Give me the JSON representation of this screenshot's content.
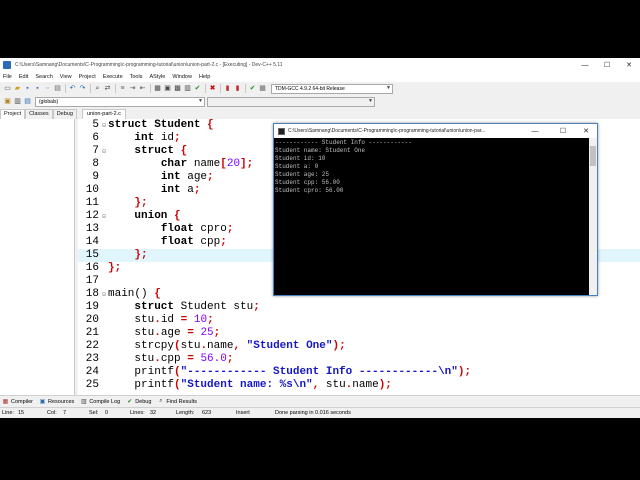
{
  "window": {
    "title": "C:\\Users\\Samnang\\Documents\\C-Programming\\c-programming-tutorial\\union\\union-part-2.c - [Executing] - Dev-C++ 5.11",
    "minimize": "—",
    "maximize": "☐",
    "close": "✕"
  },
  "menu": [
    "File",
    "Edit",
    "Search",
    "View",
    "Project",
    "Execute",
    "Tools",
    "AStyle",
    "Window",
    "Help"
  ],
  "toolbar": {
    "compiler_combo": "TDM-GCC 4.9.2 64-bit Release",
    "scope_combo": "(globals)",
    "symbol_combo": ""
  },
  "left_panel": {
    "tabs": [
      "Project",
      "Classes",
      "Debug"
    ]
  },
  "editor": {
    "tab_label": "union-part-2.c",
    "lines": [
      {
        "n": "5",
        "fold": "⊟",
        "hl": false,
        "segs": [
          [
            "kw",
            "struct Student "
          ],
          [
            "sym",
            "{"
          ]
        ]
      },
      {
        "n": "6",
        "fold": "",
        "hl": false,
        "segs": [
          [
            "t",
            "    "
          ],
          [
            "kw",
            "int"
          ],
          [
            "t",
            " id"
          ],
          [
            "sym",
            ";"
          ]
        ]
      },
      {
        "n": "7",
        "fold": "⊟",
        "hl": false,
        "segs": [
          [
            "t",
            "    "
          ],
          [
            "kw",
            "struct"
          ],
          [
            "t",
            " "
          ],
          [
            "sym",
            "{"
          ]
        ]
      },
      {
        "n": "8",
        "fold": "",
        "hl": false,
        "segs": [
          [
            "t",
            "        "
          ],
          [
            "kw",
            "char"
          ],
          [
            "t",
            " name"
          ],
          [
            "sym",
            "["
          ],
          [
            "num",
            "20"
          ],
          [
            "sym",
            "];"
          ]
        ]
      },
      {
        "n": "9",
        "fold": "",
        "hl": false,
        "segs": [
          [
            "t",
            "        "
          ],
          [
            "kw",
            "int"
          ],
          [
            "t",
            " age"
          ],
          [
            "sym",
            ";"
          ]
        ]
      },
      {
        "n": "10",
        "fold": "",
        "hl": false,
        "segs": [
          [
            "t",
            "        "
          ],
          [
            "kw",
            "int"
          ],
          [
            "t",
            " a"
          ],
          [
            "sym",
            ";"
          ]
        ]
      },
      {
        "n": "11",
        "fold": "",
        "hl": false,
        "segs": [
          [
            "t",
            "    "
          ],
          [
            "sym",
            "};"
          ]
        ]
      },
      {
        "n": "12",
        "fold": "⊟",
        "hl": false,
        "segs": [
          [
            "t",
            "    "
          ],
          [
            "kw",
            "union"
          ],
          [
            "t",
            " "
          ],
          [
            "sym",
            "{"
          ]
        ]
      },
      {
        "n": "13",
        "fold": "",
        "hl": false,
        "segs": [
          [
            "t",
            "        "
          ],
          [
            "kw",
            "float"
          ],
          [
            "t",
            " cpro"
          ],
          [
            "sym",
            ";"
          ]
        ]
      },
      {
        "n": "14",
        "fold": "",
        "hl": false,
        "segs": [
          [
            "t",
            "        "
          ],
          [
            "kw",
            "float"
          ],
          [
            "t",
            " cpp"
          ],
          [
            "sym",
            ";"
          ]
        ]
      },
      {
        "n": "15",
        "fold": "",
        "hl": true,
        "segs": [
          [
            "t",
            "    "
          ],
          [
            "sym",
            "};"
          ]
        ]
      },
      {
        "n": "16",
        "fold": "",
        "hl": false,
        "segs": [
          [
            "sym",
            "};"
          ]
        ]
      },
      {
        "n": "17",
        "fold": "",
        "hl": false,
        "segs": []
      },
      {
        "n": "18",
        "fold": "⊟",
        "hl": false,
        "segs": [
          [
            "t",
            "main() "
          ],
          [
            "sym",
            "{"
          ]
        ]
      },
      {
        "n": "19",
        "fold": "",
        "hl": false,
        "segs": [
          [
            "t",
            "    "
          ],
          [
            "kw",
            "struct"
          ],
          [
            "t",
            " Student stu"
          ],
          [
            "sym",
            ";"
          ]
        ]
      },
      {
        "n": "20",
        "fold": "",
        "hl": false,
        "segs": [
          [
            "t",
            "    stu"
          ],
          [
            "sym",
            "."
          ],
          [
            "t",
            "id "
          ],
          [
            "sym",
            "="
          ],
          [
            "t",
            " "
          ],
          [
            "num",
            "10"
          ],
          [
            "sym",
            ";"
          ]
        ]
      },
      {
        "n": "21",
        "fold": "",
        "hl": false,
        "segs": [
          [
            "t",
            "    stu"
          ],
          [
            "sym",
            "."
          ],
          [
            "t",
            "age "
          ],
          [
            "sym",
            "="
          ],
          [
            "t",
            " "
          ],
          [
            "num",
            "25"
          ],
          [
            "sym",
            ";"
          ]
        ]
      },
      {
        "n": "22",
        "fold": "",
        "hl": false,
        "segs": [
          [
            "t",
            "    strcpy"
          ],
          [
            "sym",
            "("
          ],
          [
            "t",
            "stu"
          ],
          [
            "sym",
            "."
          ],
          [
            "t",
            "name"
          ],
          [
            "sym",
            ","
          ],
          [
            "t",
            " "
          ],
          [
            "str",
            "\"Student One\""
          ],
          [
            "sym",
            ");"
          ]
        ]
      },
      {
        "n": "23",
        "fold": "",
        "hl": false,
        "segs": [
          [
            "t",
            "    stu"
          ],
          [
            "sym",
            "."
          ],
          [
            "t",
            "cpp "
          ],
          [
            "sym",
            "="
          ],
          [
            "t",
            " "
          ],
          [
            "num",
            "56.0"
          ],
          [
            "sym",
            ";"
          ]
        ]
      },
      {
        "n": "24",
        "fold": "",
        "hl": false,
        "segs": [
          [
            "t",
            "    printf"
          ],
          [
            "sym",
            "("
          ],
          [
            "str",
            "\"------------ Student Info ------------\\n\""
          ],
          [
            "sym",
            ");"
          ]
        ]
      },
      {
        "n": "25",
        "fold": "",
        "hl": false,
        "segs": [
          [
            "t",
            "    printf"
          ],
          [
            "sym",
            "("
          ],
          [
            "str",
            "\"Student name: %s\\n\""
          ],
          [
            "sym",
            ","
          ],
          [
            "t",
            " stu"
          ],
          [
            "sym",
            "."
          ],
          [
            "t",
            "name"
          ],
          [
            "sym",
            ");"
          ]
        ]
      }
    ]
  },
  "console": {
    "title": "C:\\Users\\Samnang\\Documents\\C-Programming\\c-programming-tutorial\\union\\union-par...",
    "minimize": "—",
    "maximize": "☐",
    "close": "✕",
    "output": [
      "------------ Student Info ------------",
      "Student name: Student One",
      "Student id: 10",
      "Student a: 0",
      "Student age: 25",
      "Student cpp: 56.00",
      "Student cpro: 56.00"
    ]
  },
  "bottom_tabs": [
    {
      "label": "Compiler",
      "icon": "compiler-icon"
    },
    {
      "label": "Resources",
      "icon": "resources-icon"
    },
    {
      "label": "Compile Log",
      "icon": "compile-log-icon"
    },
    {
      "label": "Debug",
      "icon": "debug-icon"
    },
    {
      "label": "Find Results",
      "icon": "find-results-icon"
    }
  ],
  "status": {
    "line_label": "Line:",
    "line_value": "15",
    "col_label": "Col:",
    "col_value": "7",
    "sel_label": "Sel:",
    "sel_value": "0",
    "lines_label": "Lines:",
    "lines_value": "32",
    "length_label": "Length:",
    "length_value": "623",
    "mode": "Insert",
    "message": "Done parsing in 0.016 seconds"
  },
  "colors": {
    "current_line": "#e1f5fd",
    "symbol": "#d00000",
    "number": "#8000ff",
    "string": "#1515c8",
    "console_bg": "#000000",
    "console_text": "#c0c0c0"
  }
}
